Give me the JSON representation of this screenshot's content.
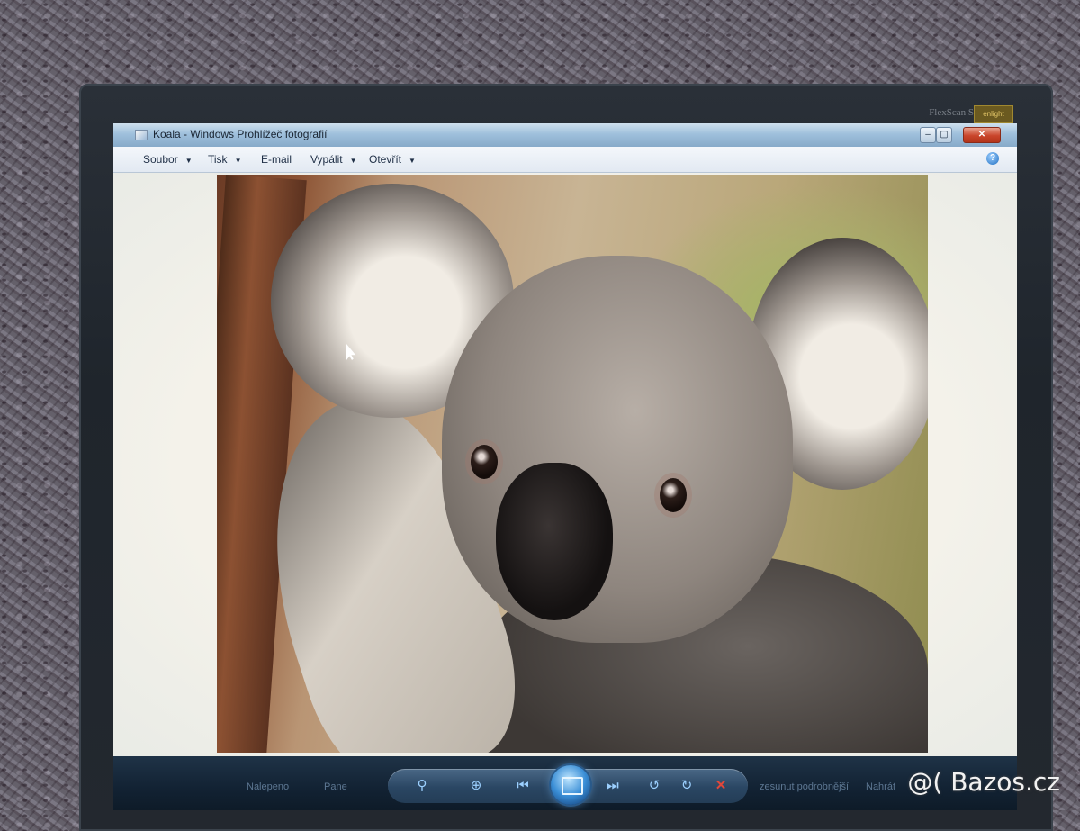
{
  "window": {
    "title": "Koala - Windows Prohlížeč fotografií",
    "controls": {
      "minimize": "‒",
      "maximize": "▢",
      "close": "✕"
    }
  },
  "menu": [
    {
      "label": "Soubor",
      "has_dropdown": true
    },
    {
      "label": "Tisk",
      "has_dropdown": true
    },
    {
      "label": "E-mail",
      "has_dropdown": false
    },
    {
      "label": "Vypálit",
      "has_dropdown": true
    },
    {
      "label": "Otevřít",
      "has_dropdown": true
    }
  ],
  "help": "?",
  "monitor": {
    "model": "FlexScan S1910",
    "badge": "enlight"
  },
  "image": {
    "subject": "koala"
  },
  "controls_bar": {
    "left_labels": [
      "Nalepeno",
      "Pane"
    ],
    "right_labels": [
      "zesunut podrobnější",
      "Nahrát"
    ]
  },
  "icons": {
    "zoom": "magnifier-icon",
    "fit": "actual-size-icon",
    "prev": "previous-icon",
    "slideshow": "slideshow-icon",
    "next": "next-icon",
    "rotate_ccw": "rotate-counterclockwise-icon",
    "rotate_cw": "rotate-clockwise-icon",
    "delete": "delete-icon"
  },
  "watermark": "@( Bazos.cz",
  "colors": {
    "titlebar": "#9fc0dc",
    "taskbar": "#122233",
    "close_button": "#c9452b",
    "accent": "#3a8ed6"
  }
}
